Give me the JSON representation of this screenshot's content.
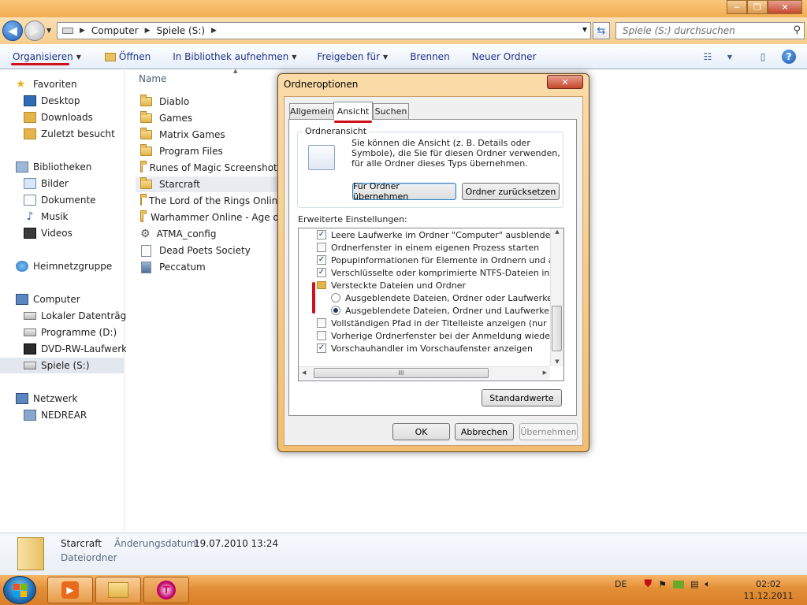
{
  "window": {
    "title": "",
    "buttons": [
      "─",
      "❐",
      "✕"
    ]
  },
  "address": {
    "crumbs": [
      "Computer",
      "Spiele (S:)"
    ],
    "search_placeholder": "Spiele (S:) durchsuchen"
  },
  "toolbar": {
    "organize": "Organisieren",
    "open": "Öffnen",
    "library": "In Bibliothek aufnehmen",
    "share": "Freigeben für",
    "burn": "Brennen",
    "new_folder": "Neuer Ordner"
  },
  "nav": {
    "favorites": "Favoriten",
    "desktop": "Desktop",
    "downloads": "Downloads",
    "recent": "Zuletzt besucht",
    "libraries": "Bibliotheken",
    "pictures": "Bilder",
    "documents": "Dokumente",
    "music": "Musik",
    "videos": "Videos",
    "homegroup": "Heimnetzgruppe",
    "computer": "Computer",
    "local_disk": "Lokaler Datenträger",
    "programs": "Programme (D:)",
    "dvd": "DVD-RW-Laufwerk (",
    "games": "Spiele (S:)",
    "network": "Netzwerk",
    "nedrear": "NEDREAR"
  },
  "files": {
    "column_name": "Name",
    "items": [
      {
        "name": "Diablo",
        "type": "folder"
      },
      {
        "name": "Games",
        "type": "folder"
      },
      {
        "name": "Matrix Games",
        "type": "folder"
      },
      {
        "name": "Program Files",
        "type": "folder"
      },
      {
        "name": "Runes of Magic Screenshots",
        "type": "folder"
      },
      {
        "name": "Starcraft",
        "type": "folder"
      },
      {
        "name": "The Lord of the Rings Online",
        "type": "folder"
      },
      {
        "name": "Warhammer Online - Age of",
        "type": "folder"
      },
      {
        "name": "ATMA_config",
        "type": "config"
      },
      {
        "name": "Dead Poets Society",
        "type": "file"
      },
      {
        "name": "Peccatum",
        "type": "image"
      }
    ]
  },
  "details": {
    "name": "Starcraft",
    "date_label": "Änderungsdatum:",
    "date_value": "19.07.2010 13:24",
    "type": "Dateiordner"
  },
  "dialog": {
    "title": "Ordneroptionen",
    "close": "✕",
    "tabs": [
      "Allgemein",
      "Ansicht",
      "Suchen"
    ],
    "active_tab": "Ansicht",
    "group_label": "Ordneransicht",
    "group_text": "Sie können die Ansicht (z. B. Details oder Symbole), die Sie für diesen Ordner verwenden, für alle Ordner dieses Typs übernehmen.",
    "apply_folders": "Für Ordner übernehmen",
    "reset_folders": "Ordner zurücksetzen",
    "advanced_label": "Erweiterte Einstellungen:",
    "options": [
      {
        "text": "Leere Laufwerke im Ordner \"Computer\" ausblenden",
        "kind": "checkbox",
        "checked": true
      },
      {
        "text": "Ordnerfenster in einem eigenen Prozess starten",
        "kind": "checkbox",
        "checked": false
      },
      {
        "text": "Popupinformationen für Elemente in Ordnern und auf dem D",
        "kind": "checkbox",
        "checked": true
      },
      {
        "text": "Verschlüsselte oder komprimierte NTFS-Dateien in anderer",
        "kind": "checkbox",
        "checked": true
      },
      {
        "text": "Versteckte Dateien und Ordner",
        "kind": "folder",
        "checked": false
      },
      {
        "text": "Ausgeblendete Dateien, Ordner oder Laufwerke nicht a",
        "kind": "radio",
        "checked": false
      },
      {
        "text": "Ausgeblendete Dateien, Ordner und Laufwerke anzeig",
        "kind": "radio",
        "checked": true
      },
      {
        "text": "Vollständigen Pfad in der Titelleiste anzeigen (nur klassisch",
        "kind": "checkbox",
        "checked": false
      },
      {
        "text": "Vorherige Ordnerfenster bei der Anmeldung wiederherstellen",
        "kind": "checkbox",
        "checked": false
      },
      {
        "text": "Vorschauhandler im Vorschaufenster anzeigen",
        "kind": "checkbox",
        "checked": true
      }
    ],
    "hscroll_grip": "III",
    "defaults": "Standardwerte",
    "ok": "OK",
    "cancel": "Abbrechen",
    "apply": "Übernehmen"
  },
  "taskbar": {
    "lang": "DE",
    "time": "02:02",
    "date": "11.12.2011"
  },
  "colors": {
    "accent_red": "#d0101a",
    "taskbar": "#e28f35",
    "link_blue": "#1e3287"
  }
}
